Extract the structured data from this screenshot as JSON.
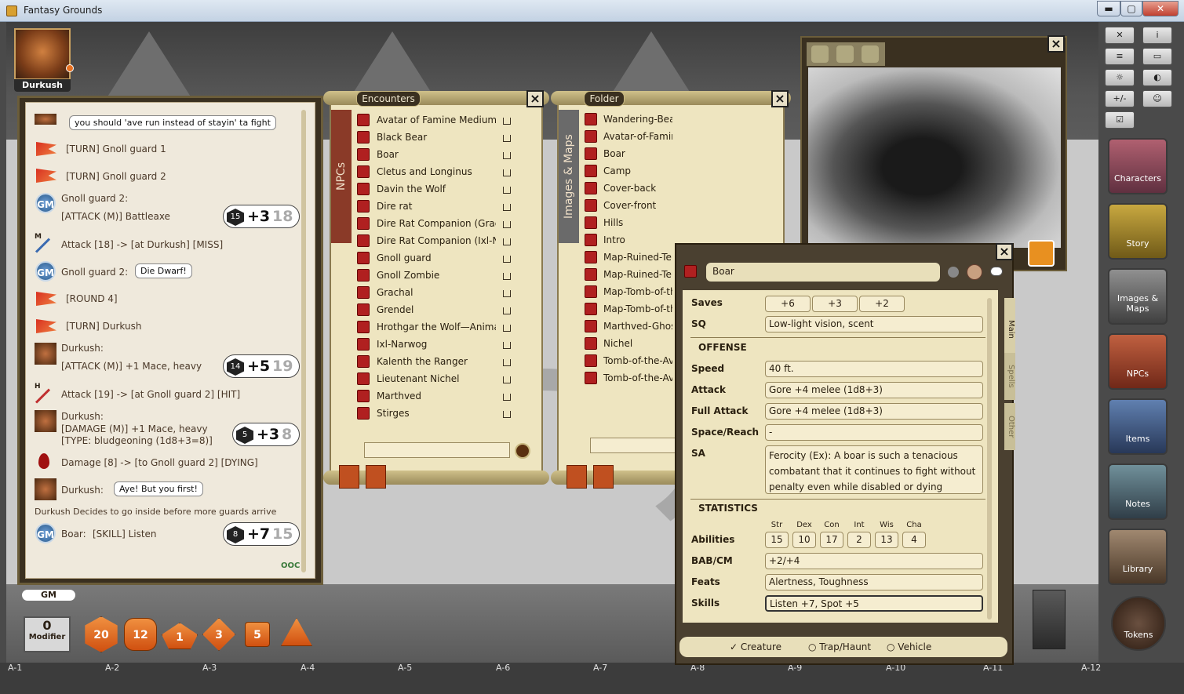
{
  "window": {
    "title": "Fantasy Grounds",
    "minimize": "▬",
    "maximize": "▢",
    "close": "✕"
  },
  "portrait": {
    "name": "Durkush"
  },
  "chat": {
    "messages": [
      {
        "speaker": "",
        "text": "you should 'ave run instead of stayin' ta fight"
      },
      {
        "text": "[TURN] Gnoll guard 1"
      },
      {
        "text": "[TURN] Gnoll guard 2"
      },
      {
        "speaker": "Gnoll guard 2:",
        "text": "[ATTACK (M)] Battleaxe",
        "die": "15",
        "mod": "+3",
        "total": "18"
      },
      {
        "letter": "M",
        "text": "Attack [18] -> [at Durkush] [MISS]"
      },
      {
        "speaker": "Gnoll guard 2:",
        "text": "Die Dwarf!"
      },
      {
        "text": "[ROUND 4]"
      },
      {
        "text": "[TURN] Durkush"
      },
      {
        "speaker": "Durkush:",
        "text": "[ATTACK (M)] +1 Mace, heavy",
        "die": "14",
        "mod": "+5",
        "total": "19"
      },
      {
        "letter": "H",
        "text": "Attack [19] -> [at Gnoll guard 2] [HIT]"
      },
      {
        "speaker": "Durkush:",
        "text": "[DAMAGE (M)] +1 Mace, heavy",
        "text2": "[TYPE: bludgeoning (1d8+3=8)]",
        "die": "5",
        "mod": "+3",
        "total": "8"
      },
      {
        "text": "Damage [8] -> [to Gnoll guard 2] [DYING]"
      },
      {
        "speaker": "Durkush:",
        "text": "Aye! But you first!"
      },
      {
        "text": "Durkush Decides to go inside before more guards arrive"
      },
      {
        "speaker": "Boar:",
        "text": "[SKILL] Listen",
        "die": "8",
        "mod": "+7",
        "total": "15"
      }
    ],
    "gm_label": "GM",
    "ooc": "OOC"
  },
  "encounters": {
    "tab": "Encounters",
    "side_tab": "NPCs",
    "items": [
      "Avatar of Famine Medium U",
      "Black Bear",
      "Boar",
      "Cletus and Longinus",
      "Davin the Wolf",
      "Dire rat",
      "Dire Rat Companion (Gracha",
      "Dire Rat Companion (Ixl-Na",
      "Gnoll guard",
      "Gnoll Zombie",
      "Grachal",
      "Grendel",
      "Hrothgar the Wolf—Animal",
      "Ixl-Narwog",
      "Kalenth the Ranger",
      "Lieutenant Nichel",
      "Marthved",
      "Stirges"
    ]
  },
  "images": {
    "tab": "Folder",
    "side_tab": "Images & Maps",
    "items": [
      "Wandering-Bear",
      "Avatar-of-Famine",
      "Boar",
      "Camp",
      "Cover-back",
      "Cover-front",
      "Hills",
      "Intro",
      "Map-Ruined-Ten",
      "Map-Ruined-Ten",
      "Map-Tomb-of-th",
      "Map-Tomb-of-th",
      "Marthved-Ghost",
      "Nichel",
      "Tomb-of-the-Ava",
      "Tomb-of-the-Ava"
    ]
  },
  "boar": {
    "name": "Boar",
    "saves_label": "Saves",
    "saves": [
      "+6",
      "+3",
      "+2"
    ],
    "sq_label": "SQ",
    "sq": "Low-light vision, scent",
    "offense_hdr": "OFFENSE",
    "speed_label": "Speed",
    "speed": "40 ft.",
    "attack_label": "Attack",
    "attack": "Gore +4 melee (1d8+3)",
    "full_attack_label": "Full Attack",
    "full_attack": "Gore +4 melee (1d8+3)",
    "space_label": "Space/Reach",
    "space": "-",
    "sa_label": "SA",
    "sa": "Ferocity (Ex): A boar is such a tenacious combatant that it continues to fight without penalty even while disabled or dying",
    "stats_hdr": "STATISTICS",
    "abilities_label": "Abilities",
    "ability_names": [
      "Str",
      "Dex",
      "Con",
      "Int",
      "Wis",
      "Cha"
    ],
    "ability_values": [
      "15",
      "10",
      "17",
      "2",
      "13",
      "4"
    ],
    "bab_label": "BAB/CM",
    "bab": "+2/+4",
    "feats_label": "Feats",
    "feats": "Alertness, Toughness",
    "skills_label": "Skills",
    "skills": "Listen +7, Spot +5",
    "tabs": [
      "Main",
      "Spells",
      "Other"
    ],
    "type_options": [
      "Creature",
      "Trap/Haunt",
      "Vehicle"
    ]
  },
  "sidebar": [
    "Characters",
    "Story",
    "Images & Maps",
    "NPCs",
    "Items",
    "Notes",
    "Library",
    "Tokens"
  ],
  "toolbar": {
    "plusminus": "+/-"
  },
  "dice": {
    "modifier_value": "0",
    "modifier_label": "Modifier",
    "d20": "20",
    "d12": "12",
    "d10": "1",
    "d8": "3",
    "d6": "5"
  },
  "grid": [
    "A-1",
    "A-2",
    "A-3",
    "A-4",
    "A-5",
    "A-6",
    "A-7",
    "A-8",
    "A-9",
    "A-10",
    "A-11",
    "A-12"
  ]
}
